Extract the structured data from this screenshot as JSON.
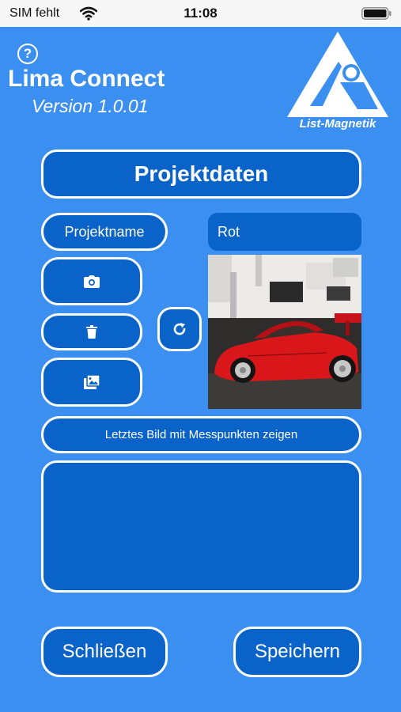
{
  "status_bar": {
    "carrier": "SIM fehlt",
    "time": "11:08",
    "wifi_icon": "wifi-icon",
    "battery_icon": "battery-icon"
  },
  "header": {
    "help_icon_glyph": "?",
    "app_title": "Lima Connect",
    "version": "Version 1.0.01",
    "logo_text": "List-Magnetik"
  },
  "section": {
    "title": "Projektdaten"
  },
  "project": {
    "name_label": "Projektname",
    "name_value": "Rot"
  },
  "buttons": {
    "camera_icon": "camera-icon",
    "delete_icon": "trash-icon",
    "gallery_icon": "photo-gallery-icon",
    "rotate_icon": "rotate-icon",
    "show_last_image": "Letztes Bild mit Messpunkten zeigen",
    "close": "Schließen",
    "save": "Speichern"
  },
  "notes": {
    "value": ""
  },
  "colors": {
    "background": "#3b8ff0",
    "button_fill": "#0a63c9",
    "border": "#ffffff",
    "car_red": "#d9171b"
  }
}
